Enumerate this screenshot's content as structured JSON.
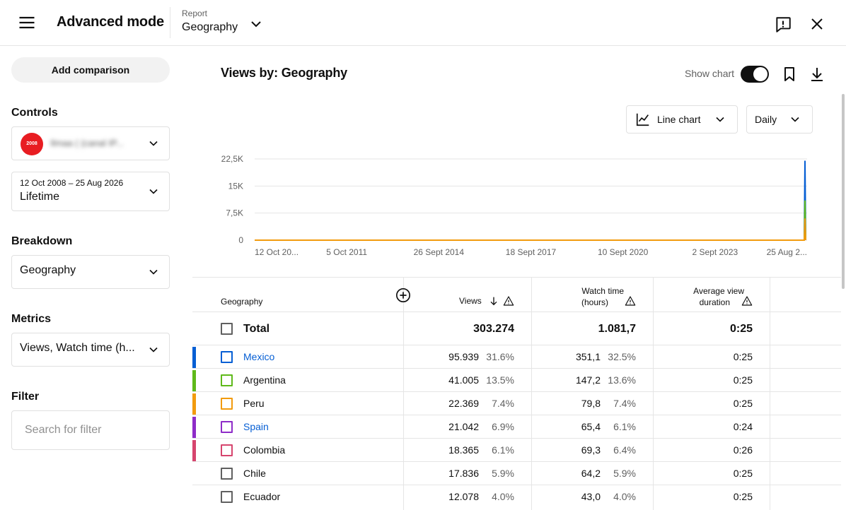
{
  "header": {
    "title": "Advanced mode",
    "report_label": "Report",
    "report_value": "Geography"
  },
  "sidebar": {
    "add_comparison": "Add comparison",
    "controls_title": "Controls",
    "channel_avatar_text": "2008",
    "channel_name": "Ilmaa ( (canal IP...",
    "date_range": "12 Oct 2008 – 25 Aug 2026",
    "date_value": "Lifetime",
    "breakdown_title": "Breakdown",
    "breakdown_value": "Geography",
    "metrics_title": "Metrics",
    "metrics_value": "Views, Watch time (h...",
    "filter_title": "Filter",
    "filter_placeholder": "Search for filter"
  },
  "main": {
    "title": "Views by: Geography",
    "show_chart_label": "Show chart",
    "show_chart_on": true,
    "chart_type_label": "Line chart",
    "interval_label": "Daily"
  },
  "chart_data": {
    "type": "line",
    "y_ticks": [
      "22,5K",
      "15K",
      "7,5K",
      "0"
    ],
    "y_tick_values": [
      22500,
      15000,
      7500,
      0
    ],
    "ylim": [
      0,
      22500
    ],
    "x_ticks": [
      "12 Oct 20...",
      "5 Oct 2011",
      "26 Sept 2014",
      "18 Sept 2017",
      "10 Sept 2020",
      "2 Sept 2023",
      "25 Aug 2..."
    ],
    "grid": true,
    "series": [
      {
        "name": "Mexico",
        "color": "#065fd4",
        "spike_value": 22000,
        "baseline": 0
      },
      {
        "name": "Argentina",
        "color": "#5fb91a",
        "spike_value": 11000,
        "baseline": 0
      },
      {
        "name": "Peru",
        "color": "#f29b0e",
        "spike_value": 6000,
        "baseline": 0
      }
    ]
  },
  "table": {
    "headers": {
      "geography": "Geography",
      "views": "Views",
      "watch_time_1": "Watch time",
      "watch_time_2": "(hours)",
      "avg_1": "Average view",
      "avg_2": "duration"
    },
    "total": {
      "label": "Total",
      "views": "303.274",
      "watch_time": "1.081,7",
      "avg": "0:25"
    },
    "rows": [
      {
        "name": "Mexico",
        "link": true,
        "color": "#065fd4",
        "views": "95.939",
        "views_pct": "31.6%",
        "watch": "351,1",
        "watch_pct": "32.5%",
        "avg": "0:25"
      },
      {
        "name": "Argentina",
        "link": false,
        "color": "#5fb91a",
        "views": "41.005",
        "views_pct": "13.5%",
        "watch": "147,2",
        "watch_pct": "13.6%",
        "avg": "0:25"
      },
      {
        "name": "Peru",
        "link": false,
        "color": "#f29b0e",
        "views": "22.369",
        "views_pct": "7.4%",
        "watch": "79,8",
        "watch_pct": "7.4%",
        "avg": "0:25"
      },
      {
        "name": "Spain",
        "link": true,
        "color": "#8e2cc8",
        "views": "21.042",
        "views_pct": "6.9%",
        "watch": "65,4",
        "watch_pct": "6.1%",
        "avg": "0:24"
      },
      {
        "name": "Colombia",
        "link": false,
        "color": "#d6456e",
        "views": "18.365",
        "views_pct": "6.1%",
        "watch": "69,3",
        "watch_pct": "6.4%",
        "avg": "0:26"
      },
      {
        "name": "Chile",
        "link": false,
        "color": "",
        "views": "17.836",
        "views_pct": "5.9%",
        "watch": "64,2",
        "watch_pct": "5.9%",
        "avg": "0:25"
      },
      {
        "name": "Ecuador",
        "link": false,
        "color": "",
        "views": "12.078",
        "views_pct": "4.0%",
        "watch": "43,0",
        "watch_pct": "4.0%",
        "avg": "0:25"
      }
    ]
  }
}
